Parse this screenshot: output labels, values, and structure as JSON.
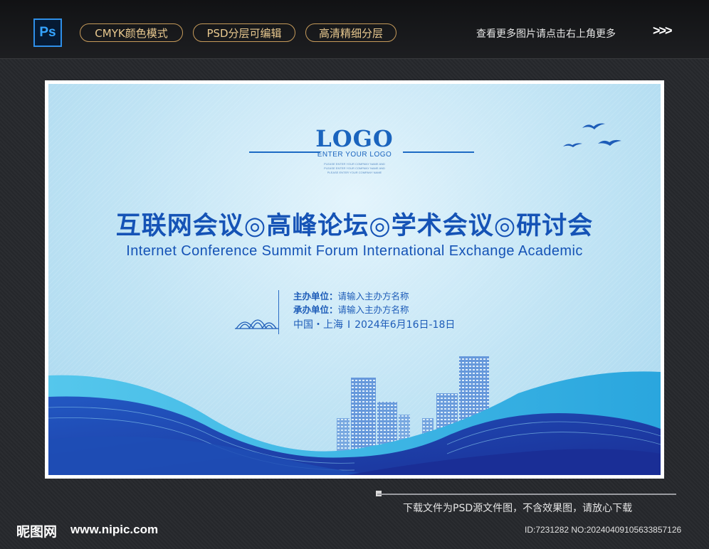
{
  "top_bar": {
    "ps_icon_label": "Ps",
    "badges": [
      "CMYK颜色模式",
      "PSD分层可编辑",
      "高清精细分层"
    ],
    "more_text": "查看更多图片请点击右上角更多",
    "more_arrows": ">>>"
  },
  "poster": {
    "logo_text": "LOGO",
    "logo_sub": "ENTER YOUR LOGO",
    "logo_small_lines": [
      "PLEASE ENTER YOUR COMPANY NAME AND",
      "PLEASE ENTER YOUR COMPANY NAME AND",
      "PLEASE ENTER YOUR COMPANY NAME"
    ],
    "title_cn": "互联网会议◎高峰论坛◎学术会议◎研讨会",
    "title_en": "Internet Conference Summit Forum International Exchange Academic",
    "host_label": "主办单位：",
    "host_value": "请输入主办方名称",
    "organizer_label": "承办单位：",
    "organizer_value": "请输入主办方名称",
    "location": "中国・上海",
    "separator": "I",
    "date": "2024年6月16日-18日",
    "colors": {
      "primary_blue": "#1553b6",
      "wave_dark": "#1b3fa3",
      "wave_light": "#3fc0e6"
    }
  },
  "footer": {
    "note": "下载文件为PSD源文件图，不含效果图，请放心下载",
    "site_cn": "昵图网",
    "site_url": "www.nipic.com",
    "id_text": "ID:7231282 NO:20240409105633857126"
  }
}
